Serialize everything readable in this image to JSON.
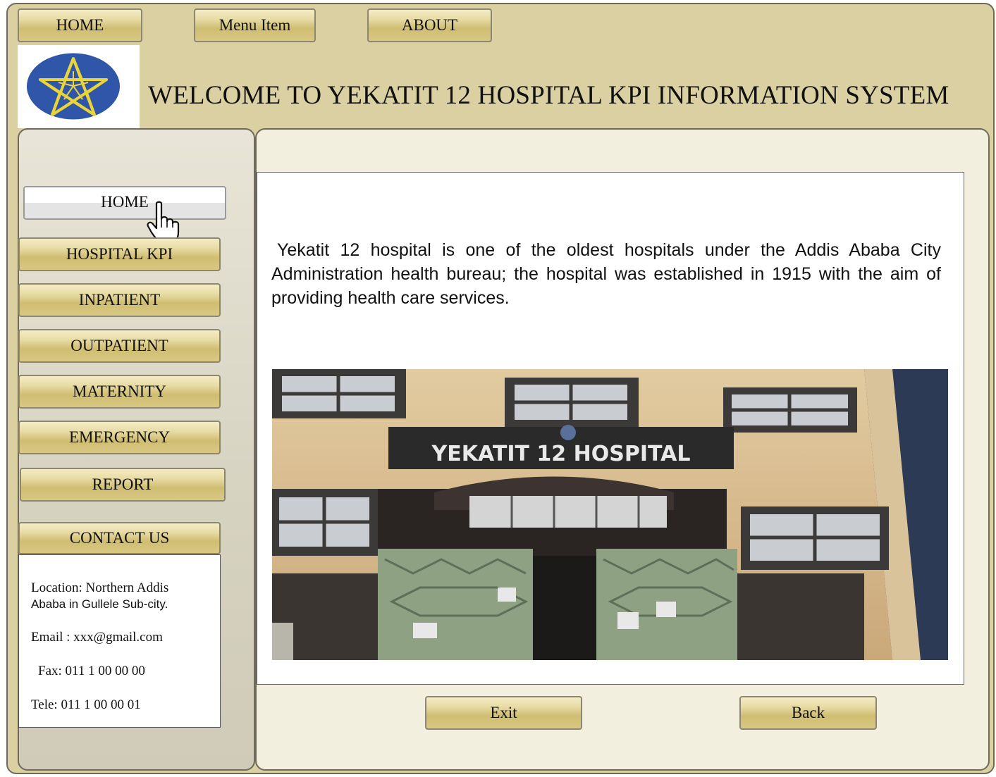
{
  "topnav": {
    "home": "HOME",
    "menu_item": "Menu Item",
    "about": "ABOUT"
  },
  "header": {
    "title": "WELCOME TO YEKATIT 12 HOSPITAL KPI INFORMATION SYSTEM",
    "logo_icon": "ethiopian-emblem-star-icon"
  },
  "sidebar": {
    "items": [
      {
        "label": "HOME",
        "active": true
      },
      {
        "label": "HOSPITAL KPI"
      },
      {
        "label": "INPATIENT"
      },
      {
        "label": "OUTPATIENT"
      },
      {
        "label": "MATERNITY"
      },
      {
        "label": "EMERGENCY"
      },
      {
        "label": "REPORT"
      },
      {
        "label": "CONTACT US"
      }
    ],
    "contact": {
      "location_1": "Location: Northern Addis",
      "location_2": "Ababa in Gullele Sub-city.",
      "email": "Email : xxx@gmail.com",
      "fax": "Fax: 011 1  00 00 00",
      "tele": "Tele: 011 1 00 00 01"
    }
  },
  "main": {
    "description": "Yekatit 12 hospital  is one of the oldest hospitals under the Addis Ababa City Administration health bureau; the hospital was established in 1915 with the aim of providing health care services.",
    "photo_sign": "YEKATIT 12 HOSPITAL",
    "exit_label": "Exit",
    "back_label": "Back"
  },
  "colors": {
    "background": "#dbd0a1",
    "button_gold": "#cfbd72",
    "border": "#6e6a5c"
  }
}
